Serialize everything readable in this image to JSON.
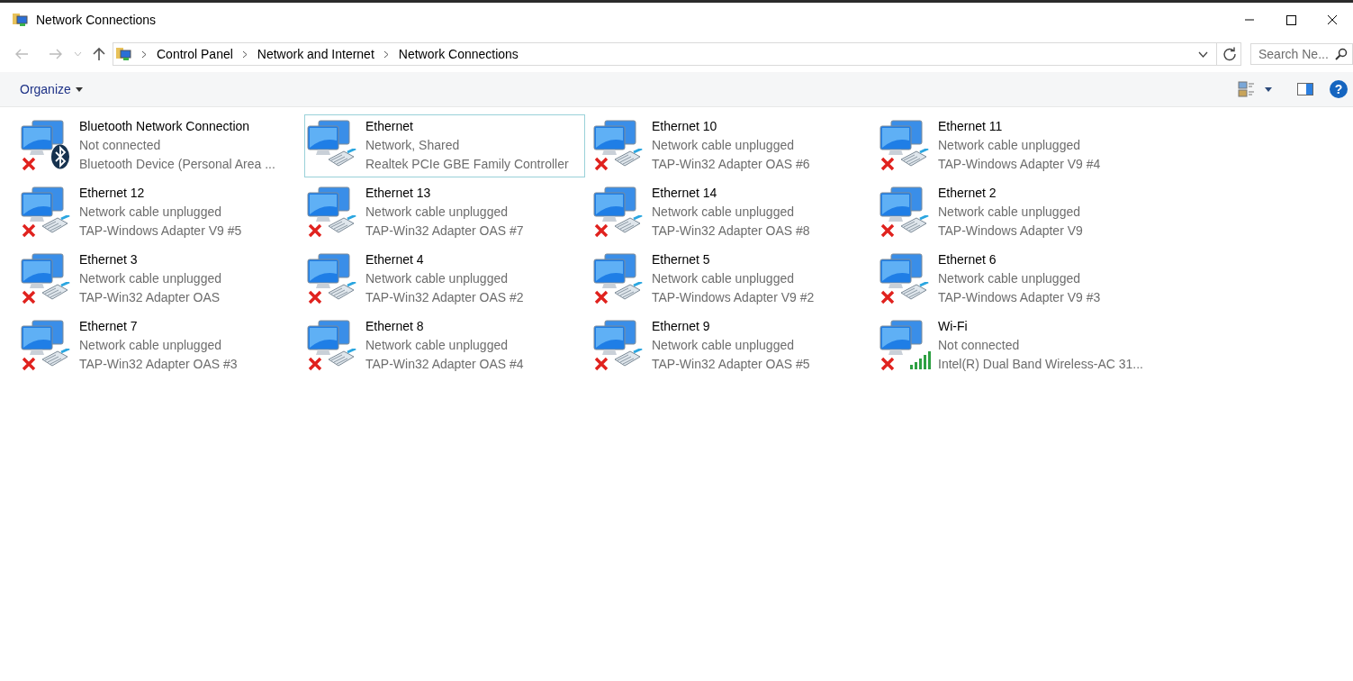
{
  "window": {
    "title": "Network Connections"
  },
  "address": {
    "crumbs": [
      "Control Panel",
      "Network and Internet",
      "Network Connections"
    ]
  },
  "search": {
    "placeholder": "Search Ne..."
  },
  "toolbar": {
    "organize": "Organize"
  },
  "help": "?",
  "items": [
    {
      "name": "Bluetooth Network Connection",
      "status": "Not connected",
      "device": "Bluetooth Device (Personal Area ...",
      "kind": "bluetooth",
      "disconnected": true,
      "selected": false
    },
    {
      "name": "Ethernet",
      "status": "Network, Shared",
      "device": "Realtek PCIe GBE Family Controller",
      "kind": "ethernet",
      "disconnected": false,
      "selected": true
    },
    {
      "name": "Ethernet 10",
      "status": "Network cable unplugged",
      "device": "TAP-Win32 Adapter OAS #6",
      "kind": "ethernet",
      "disconnected": true,
      "selected": false
    },
    {
      "name": "Ethernet 11",
      "status": "Network cable unplugged",
      "device": "TAP-Windows Adapter V9 #4",
      "kind": "ethernet",
      "disconnected": true,
      "selected": false
    },
    {
      "name": "Ethernet 12",
      "status": "Network cable unplugged",
      "device": "TAP-Windows Adapter V9 #5",
      "kind": "ethernet",
      "disconnected": true,
      "selected": false
    },
    {
      "name": "Ethernet 13",
      "status": "Network cable unplugged",
      "device": "TAP-Win32 Adapter OAS #7",
      "kind": "ethernet",
      "disconnected": true,
      "selected": false
    },
    {
      "name": "Ethernet 14",
      "status": "Network cable unplugged",
      "device": "TAP-Win32 Adapter OAS #8",
      "kind": "ethernet",
      "disconnected": true,
      "selected": false
    },
    {
      "name": "Ethernet 2",
      "status": "Network cable unplugged",
      "device": "TAP-Windows Adapter V9",
      "kind": "ethernet",
      "disconnected": true,
      "selected": false
    },
    {
      "name": "Ethernet 3",
      "status": "Network cable unplugged",
      "device": "TAP-Win32 Adapter OAS",
      "kind": "ethernet",
      "disconnected": true,
      "selected": false
    },
    {
      "name": "Ethernet 4",
      "status": "Network cable unplugged",
      "device": "TAP-Win32 Adapter OAS #2",
      "kind": "ethernet",
      "disconnected": true,
      "selected": false
    },
    {
      "name": "Ethernet 5",
      "status": "Network cable unplugged",
      "device": "TAP-Windows Adapter V9 #2",
      "kind": "ethernet",
      "disconnected": true,
      "selected": false
    },
    {
      "name": "Ethernet 6",
      "status": "Network cable unplugged",
      "device": "TAP-Windows Adapter V9 #3",
      "kind": "ethernet",
      "disconnected": true,
      "selected": false
    },
    {
      "name": "Ethernet 7",
      "status": "Network cable unplugged",
      "device": "TAP-Win32 Adapter OAS #3",
      "kind": "ethernet",
      "disconnected": true,
      "selected": false
    },
    {
      "name": "Ethernet 8",
      "status": "Network cable unplugged",
      "device": "TAP-Win32 Adapter OAS #4",
      "kind": "ethernet",
      "disconnected": true,
      "selected": false
    },
    {
      "name": "Ethernet 9",
      "status": "Network cable unplugged",
      "device": "TAP-Win32 Adapter OAS #5",
      "kind": "ethernet",
      "disconnected": true,
      "selected": false
    },
    {
      "name": "Wi-Fi",
      "status": "Not connected",
      "device": "Intel(R) Dual Band Wireless-AC 31...",
      "kind": "wifi",
      "disconnected": true,
      "selected": false
    }
  ]
}
